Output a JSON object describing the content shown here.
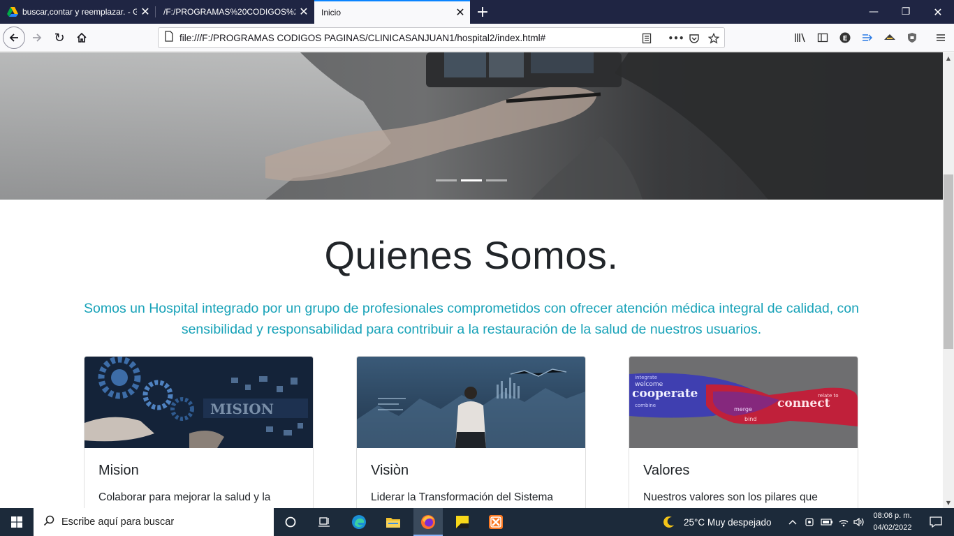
{
  "browser": {
    "tabs": [
      {
        "title": "buscar,contar y reemplazar. - G",
        "active": false
      },
      {
        "title": "/F:/PROGRAMAS%20CODIGOS%20",
        "active": false
      },
      {
        "title": "Inicio",
        "active": true
      }
    ],
    "url": "file:///F:/PROGRAMAS CODIGOS PAGINAS/CLINICASANJUAN1/hospital2/index.html#",
    "accent_color": "#0a84ff",
    "icons": {
      "close": "✕",
      "new_tab": "+",
      "minimize": "—",
      "restore": "❐",
      "window_close": "✕",
      "reload": "↻",
      "more": "•••"
    }
  },
  "page": {
    "hero": {
      "slides": 3,
      "active_slide": 2
    },
    "section_title": "Quienes Somos.",
    "section_lead": "Somos un Hospital integrado por un grupo de profesionales comprometidos con ofrecer atención médica integral de calidad, con sensibilidad y responsabilidad para contribuir a la restauración de la salud de nuestros usuarios.",
    "lead_color": "#17a2b8",
    "cards": [
      {
        "title": "Mision",
        "text": "Colaborar para mejorar la salud y la",
        "image_text": "MISION"
      },
      {
        "title": "Visiòn",
        "text": "Liderar la Transformación del Sistema"
      },
      {
        "title": "Valores",
        "text": "Nuestros valores son los pilares que",
        "image_words": [
          "welcome",
          "cooperate",
          "connect",
          "integrate",
          "combine",
          "relate to",
          "merge",
          "bind"
        ]
      }
    ]
  },
  "taskbar": {
    "search_placeholder": "Escribe aquí para buscar",
    "weather": "25°C  Muy despejado",
    "time": "08:06 p. m.",
    "date": "04/02/2022"
  }
}
